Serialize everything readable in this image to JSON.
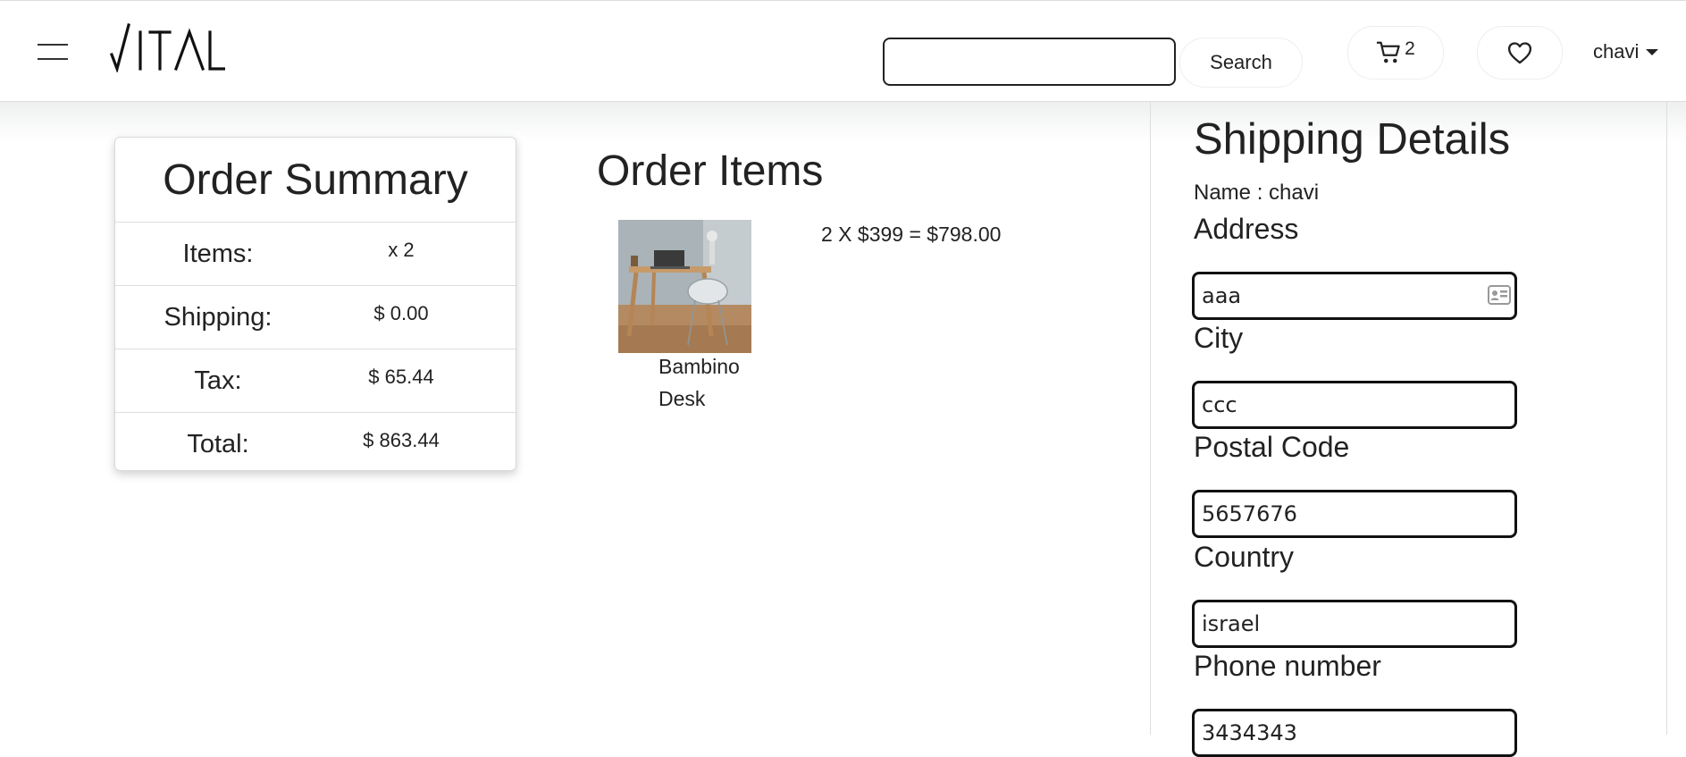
{
  "header": {
    "logo_text": "VITAL",
    "search": {
      "value": "",
      "placeholder": ""
    },
    "search_button_label": "Search",
    "cart_count": "2",
    "user_name": "chavi"
  },
  "summary": {
    "title": "Order Summary",
    "rows": [
      {
        "label": "Items:",
        "value": "x 2"
      },
      {
        "label": "Shipping:",
        "value": "$ 0.00"
      },
      {
        "label": "Tax:",
        "value": "$ 65.44"
      },
      {
        "label": "Total:",
        "value": "$ 863.44"
      }
    ]
  },
  "order_items": {
    "title": "Order Items",
    "items": [
      {
        "name": "Bambino Desk",
        "price_line": "2 X $399 = $798.00",
        "image_icon": "desk-photo"
      }
    ]
  },
  "shipping": {
    "title": "Shipping Details",
    "name_line": "Name : chavi",
    "fields": [
      {
        "label": "Address",
        "value": "aaa"
      },
      {
        "label": "City",
        "value": "ccc"
      },
      {
        "label": "Postal Code",
        "value": "5657676"
      },
      {
        "label": "Country",
        "value": "israel"
      },
      {
        "label": "Phone number",
        "value": "3434343"
      }
    ]
  },
  "icons": {
    "menu": "hamburger-icon",
    "cart": "cart-icon",
    "wishlist": "heart-icon",
    "user_caret": "caret-down-icon",
    "autofill": "contact-card-icon"
  }
}
